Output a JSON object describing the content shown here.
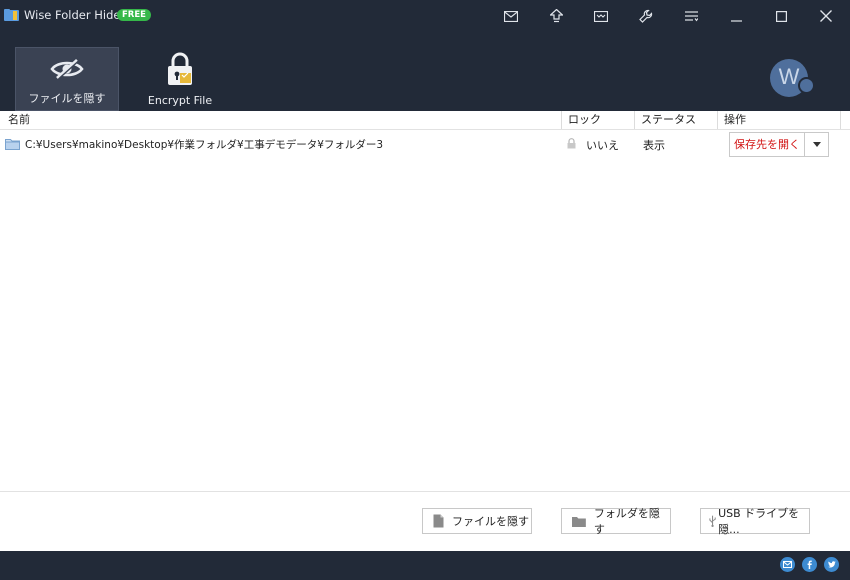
{
  "app": {
    "title": "Wise Folder Hider",
    "badge": "FREE"
  },
  "titlebar_icons": [
    "mail-icon",
    "upgrade-icon",
    "feedback-icon",
    "settings-icon",
    "menu-icon",
    "minimize-icon",
    "maximize-icon",
    "close-icon"
  ],
  "toolbar": {
    "hide_label": "ファイルを隠す",
    "encrypt_label": "Encrypt File"
  },
  "avatar": {
    "letter": "W"
  },
  "table": {
    "columns": {
      "name": "名前",
      "lock": "ロック",
      "status": "ステータス",
      "action": "操作"
    },
    "rows": [
      {
        "path": "C:¥Users¥makino¥Desktop¥作業フォルダ¥工事デモデータ¥フォルダー3",
        "lock": "いいえ",
        "status": "表示",
        "action": "保存先を開く"
      }
    ]
  },
  "bottom": {
    "hide_file": "ファイルを隠す",
    "hide_folder": "フォルダを隠す",
    "hide_usb": "USB ドライブを隠..."
  },
  "footer_social": [
    "email",
    "facebook",
    "twitter"
  ],
  "colors": {
    "header_bg": "#222a38",
    "accent_red": "#d21414",
    "badge_green": "#36b84a",
    "social_blue": "#3d8bd1"
  }
}
